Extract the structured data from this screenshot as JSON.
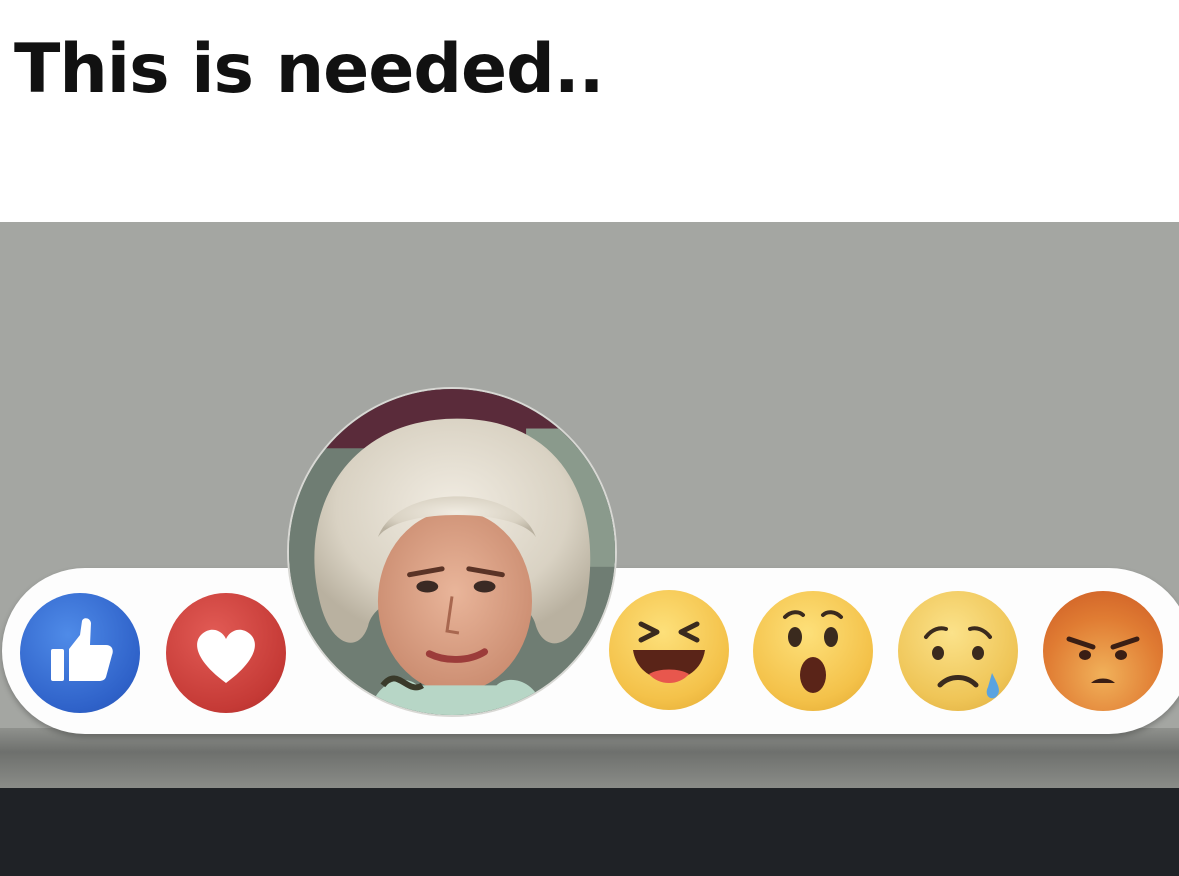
{
  "caption": "This is needed..",
  "reactions": [
    {
      "name": "like",
      "icon": "thumbs-up-icon",
      "color": "#2f62c9"
    },
    {
      "name": "love",
      "icon": "heart-icon",
      "color": "#c53a36"
    },
    {
      "name": "custom-photo",
      "icon": "photo-avatar"
    },
    {
      "name": "haha",
      "icon": "laughing-face-icon",
      "color": "#f4c24a"
    },
    {
      "name": "wow",
      "icon": "surprised-face-icon",
      "color": "#f4c24a"
    },
    {
      "name": "sad",
      "icon": "crying-face-icon",
      "color": "#efc557"
    },
    {
      "name": "angry",
      "icon": "angry-face-icon",
      "color": "#e07c33"
    }
  ]
}
